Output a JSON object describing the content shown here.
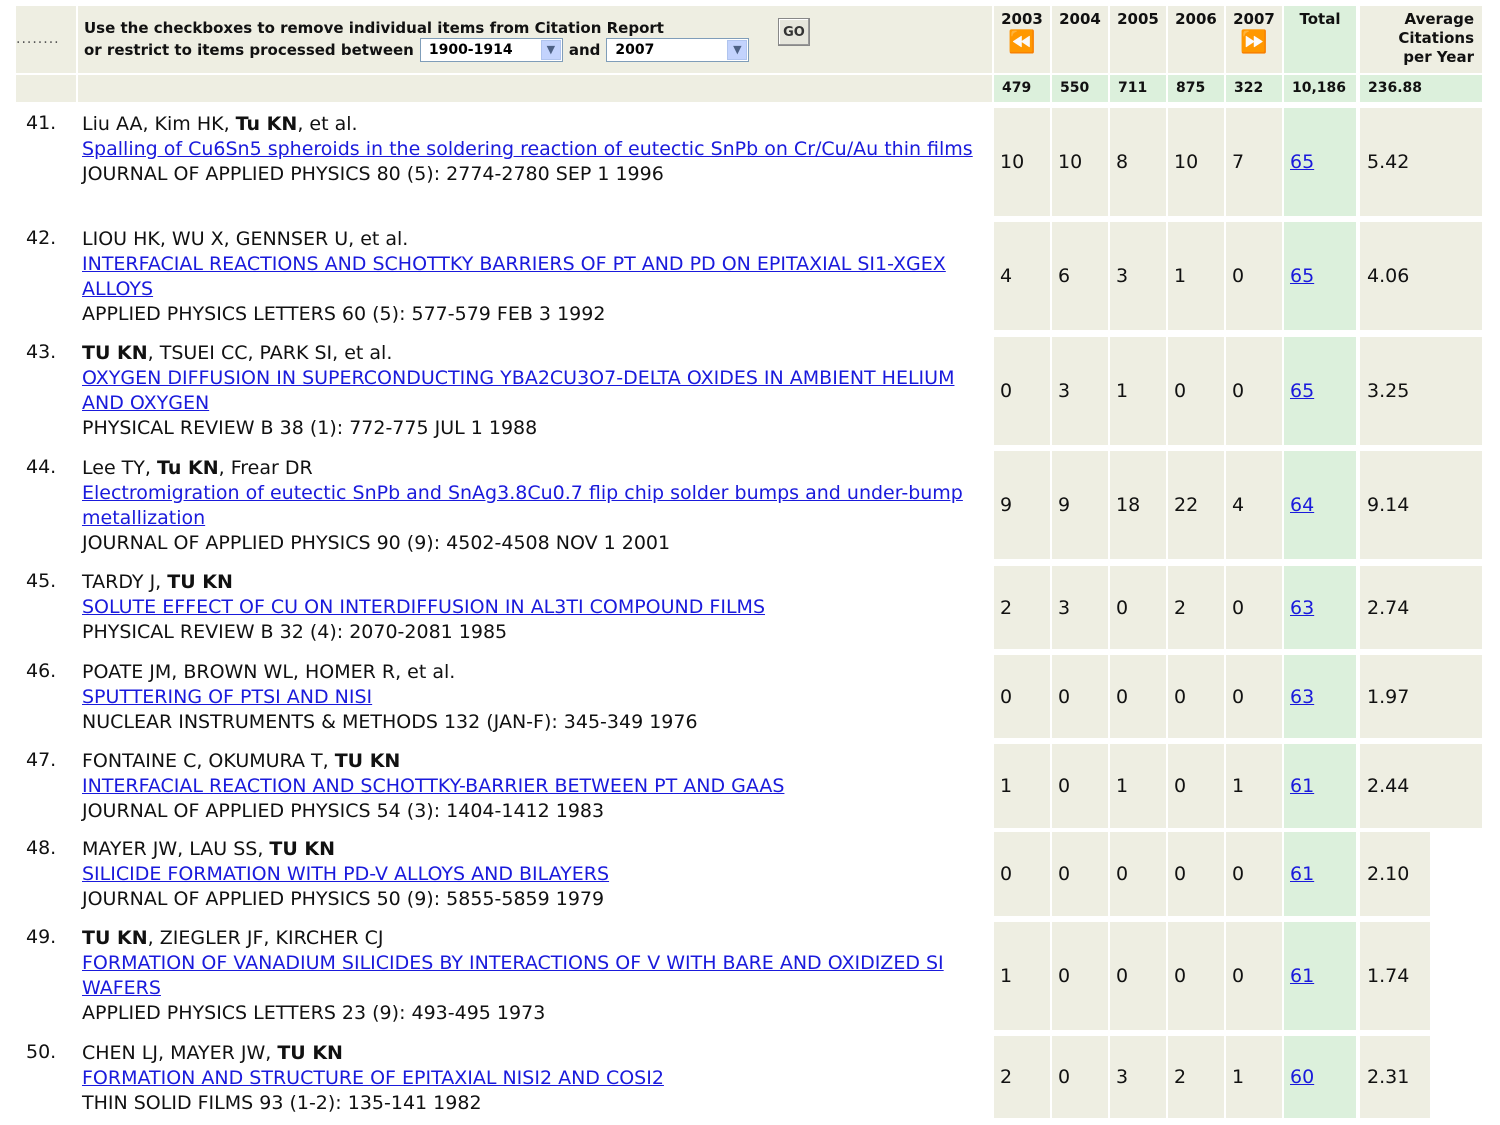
{
  "header": {
    "dots": "........",
    "line1": "Use the checkboxes to remove individual items from Citation Report",
    "line2_prefix": "or restrict to items processed between",
    "from_value": "1900-1914",
    "and_label": "and",
    "to_value": "2007",
    "go_label": "GO"
  },
  "columns": {
    "y2003": "2003",
    "y2004": "2004",
    "y2005": "2005",
    "y2006": "2006",
    "y2007": "2007",
    "total": "Total",
    "avg_line1": "Average",
    "avg_line2": "Citations",
    "avg_line3": "per Year"
  },
  "totals": {
    "y2003": "479",
    "y2004": "550",
    "y2005": "711",
    "y2006": "875",
    "y2007": "322",
    "total": "10,186",
    "avg": "236.88"
  },
  "records": [
    {
      "num": "41.",
      "authors": [
        {
          "t": "Liu AA, Kim HK, ",
          "b": false
        },
        {
          "t": "Tu KN",
          "b": true
        },
        {
          "t": ", et al.",
          "b": false
        }
      ],
      "title": "Spalling of Cu6Sn5 spheroids in the soldering reaction of eutectic SnPb on Cr/Cu/Au thin films",
      "journal": "JOURNAL OF APPLIED PHYSICS 80 (5): 2774-2780 SEP 1 1996",
      "c": [
        "10",
        "10",
        "8",
        "10",
        "7"
      ],
      "total": "65",
      "avg": "5.42"
    },
    {
      "num": "42.",
      "authors": [
        {
          "t": "LIOU HK, WU X, GENNSER U, et al.",
          "b": false
        }
      ],
      "title": "INTERFACIAL REACTIONS AND SCHOTTKY BARRIERS OF PT AND PD ON EPITAXIAL SI1-XGEX ALLOYS",
      "journal": "APPLIED PHYSICS LETTERS 60 (5): 577-579 FEB 3 1992",
      "c": [
        "4",
        "6",
        "3",
        "1",
        "0"
      ],
      "total": "65",
      "avg": "4.06"
    },
    {
      "num": "43.",
      "authors": [
        {
          "t": "TU KN",
          "b": true
        },
        {
          "t": ", TSUEI CC, PARK SI, et al.",
          "b": false
        }
      ],
      "title": "OXYGEN DIFFUSION IN SUPERCONDUCTING YBA2CU3O7-DELTA OXIDES IN AMBIENT HELIUM AND OXYGEN",
      "journal": "PHYSICAL REVIEW B 38 (1): 772-775 JUL 1 1988",
      "c": [
        "0",
        "3",
        "1",
        "0",
        "0"
      ],
      "total": "65",
      "avg": "3.25"
    },
    {
      "num": "44.",
      "authors": [
        {
          "t": "Lee TY, ",
          "b": false
        },
        {
          "t": "Tu KN",
          "b": true
        },
        {
          "t": ", Frear DR",
          "b": false
        }
      ],
      "title": "Electromigration of eutectic SnPb and SnAg3.8Cu0.7 flip chip solder bumps and under-bump metallization",
      "journal": "JOURNAL OF APPLIED PHYSICS 90 (9): 4502-4508 NOV 1 2001",
      "c": [
        "9",
        "9",
        "18",
        "22",
        "4"
      ],
      "total": "64",
      "avg": "9.14"
    },
    {
      "num": "45.",
      "authors": [
        {
          "t": "TARDY J, ",
          "b": false
        },
        {
          "t": "TU KN",
          "b": true
        }
      ],
      "title": "SOLUTE EFFECT OF CU ON INTERDIFFUSION IN AL3TI COMPOUND FILMS",
      "journal": "PHYSICAL REVIEW B 32 (4): 2070-2081 1985",
      "c": [
        "2",
        "3",
        "0",
        "2",
        "0"
      ],
      "total": "63",
      "avg": "2.74"
    },
    {
      "num": "46.",
      "authors": [
        {
          "t": "POATE JM, BROWN WL, HOMER R, et al.",
          "b": false
        }
      ],
      "title": "SPUTTERING OF PTSI AND NISI",
      "journal": "NUCLEAR INSTRUMENTS & METHODS 132 (JAN-F): 345-349 1976",
      "c": [
        "0",
        "0",
        "0",
        "0",
        "0"
      ],
      "total": "63",
      "avg": "1.97"
    },
    {
      "num": "47.",
      "authors": [
        {
          "t": "FONTAINE C, OKUMURA T, ",
          "b": false
        },
        {
          "t": "TU KN",
          "b": true
        }
      ],
      "title": "INTERFACIAL REACTION AND SCHOTTKY-BARRIER BETWEEN PT AND GAAS",
      "journal": "JOURNAL OF APPLIED PHYSICS 54 (3): 1404-1412 1983",
      "c": [
        "1",
        "0",
        "1",
        "0",
        "1"
      ],
      "total": "61",
      "avg": "2.44"
    },
    {
      "num": "48.",
      "authors": [
        {
          "t": "MAYER JW, LAU SS, ",
          "b": false
        },
        {
          "t": "TU KN",
          "b": true
        }
      ],
      "title": "SILICIDE FORMATION WITH PD-V ALLOYS AND BILAYERS",
      "journal": "JOURNAL OF APPLIED PHYSICS 50 (9): 5855-5859 1979",
      "c": [
        "0",
        "0",
        "0",
        "0",
        "0"
      ],
      "total": "61",
      "avg": "2.10"
    },
    {
      "num": "49.",
      "authors": [
        {
          "t": "TU KN",
          "b": true
        },
        {
          "t": ", ZIEGLER JF, KIRCHER CJ",
          "b": false
        }
      ],
      "title": "FORMATION OF VANADIUM SILICIDES BY INTERACTIONS OF V WITH BARE AND OXIDIZED SI WAFERS",
      "journal": "APPLIED PHYSICS LETTERS 23 (9): 493-495 1973",
      "c": [
        "1",
        "0",
        "0",
        "0",
        "0"
      ],
      "total": "61",
      "avg": "1.74"
    },
    {
      "num": "50.",
      "authors": [
        {
          "t": "CHEN LJ, MAYER JW, ",
          "b": false
        },
        {
          "t": "TU KN",
          "b": true
        }
      ],
      "title": "FORMATION AND STRUCTURE OF EPITAXIAL NISI2 AND COSI2",
      "journal": "THIN SOLID FILMS 93 (1-2): 135-141 1982",
      "c": [
        "2",
        "0",
        "3",
        "2",
        "1"
      ],
      "total": "60",
      "avg": "2.31"
    }
  ]
}
